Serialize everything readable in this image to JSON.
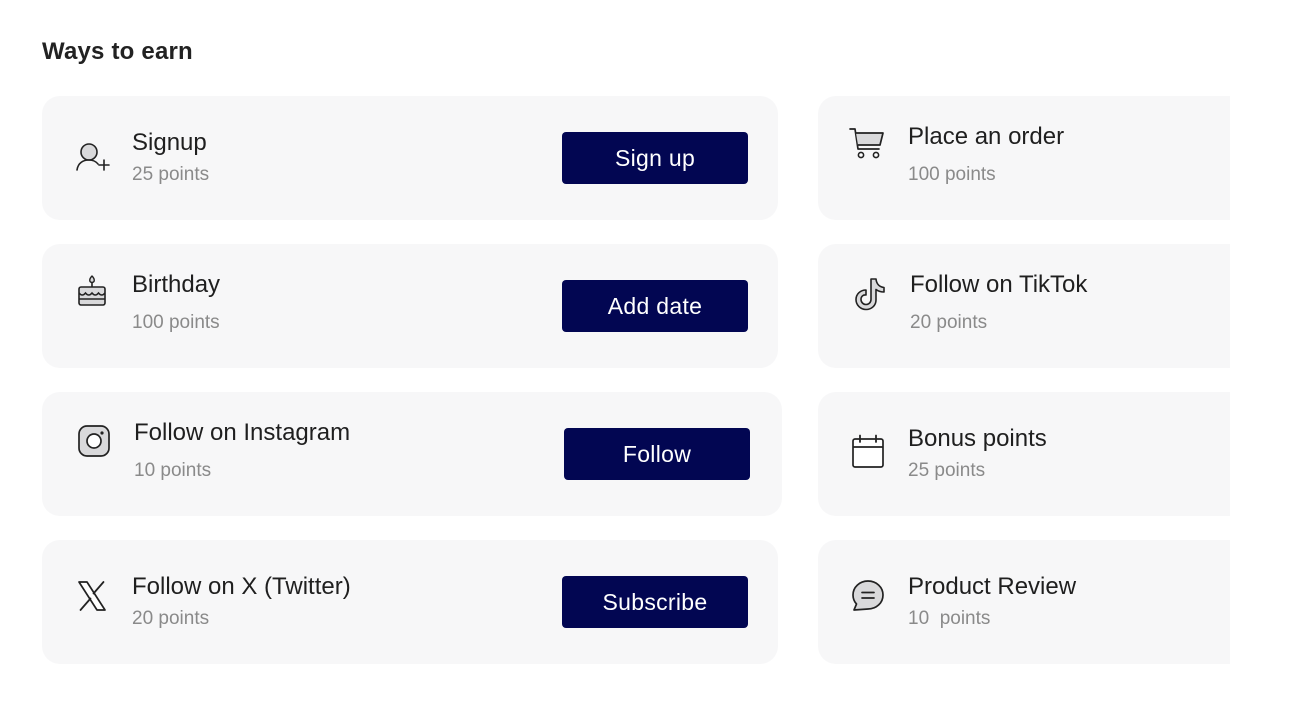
{
  "section_title": "Ways to earn",
  "colors": {
    "card_background": "#f7f7f8",
    "button_background": "#020652",
    "button_text": "#ffffff",
    "points_text": "#8a8a8a"
  },
  "left_cards": [
    {
      "icon": "user-plus-icon",
      "title": "Signup",
      "points": "25 points",
      "button": "Sign up"
    },
    {
      "icon": "birthday-cake-icon",
      "title": "Birthday",
      "points": "100 points",
      "button": "Add date"
    },
    {
      "icon": "instagram-icon",
      "title": "Follow on Instagram",
      "points": "10 points",
      "button": "Follow"
    },
    {
      "icon": "x-twitter-icon",
      "title": "Follow on X (Twitter)",
      "points": "20 points",
      "button": "Subscribe"
    }
  ],
  "right_cards": [
    {
      "icon": "shopping-cart-icon",
      "title": "Place an order",
      "points": "100 points"
    },
    {
      "icon": "tiktok-icon",
      "title": "Follow on TikTok",
      "points": "20 points"
    },
    {
      "icon": "calendar-icon",
      "title": "Bonus points",
      "points": "25 points"
    },
    {
      "icon": "chat-bubble-icon",
      "title": "Product Review",
      "points": "10  points"
    }
  ]
}
